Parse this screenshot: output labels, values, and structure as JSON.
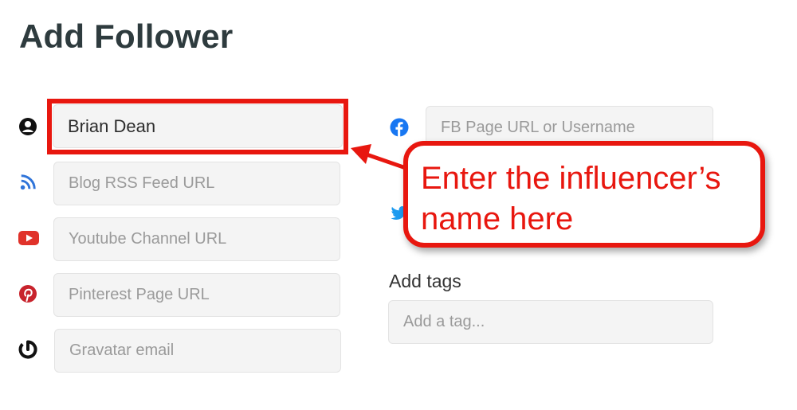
{
  "page": {
    "title": "Add Follower"
  },
  "form": {
    "name": {
      "value": "Brian Dean",
      "icon": "user-circle-icon"
    },
    "blog_rss": {
      "placeholder": "Blog RSS Feed URL",
      "icon": "rss-icon"
    },
    "youtube": {
      "placeholder": "Youtube Channel URL",
      "icon": "youtube-icon"
    },
    "pinterest": {
      "placeholder": "Pinterest Page URL",
      "icon": "pinterest-icon"
    },
    "gravatar": {
      "placeholder": "Gravatar email",
      "icon": "gravatar-icon"
    },
    "facebook": {
      "placeholder": "FB Page URL or Username",
      "icon": "facebook-icon"
    },
    "twitter": {
      "icon": "twitter-icon"
    },
    "tags": {
      "label": "Add tags",
      "placeholder": "Add a tag..."
    }
  },
  "annotation": {
    "line1": "Enter the influencer’s",
    "line2": "name here"
  },
  "colors": {
    "annotation_red": "#e8170f",
    "title": "#2e3b3e",
    "field_bg": "#f4f4f4",
    "rss": "#2f74d9",
    "youtube": "#e0322a",
    "pinterest": "#c8232c",
    "facebook": "#1877f2",
    "twitter": "#1d9bf0"
  }
}
